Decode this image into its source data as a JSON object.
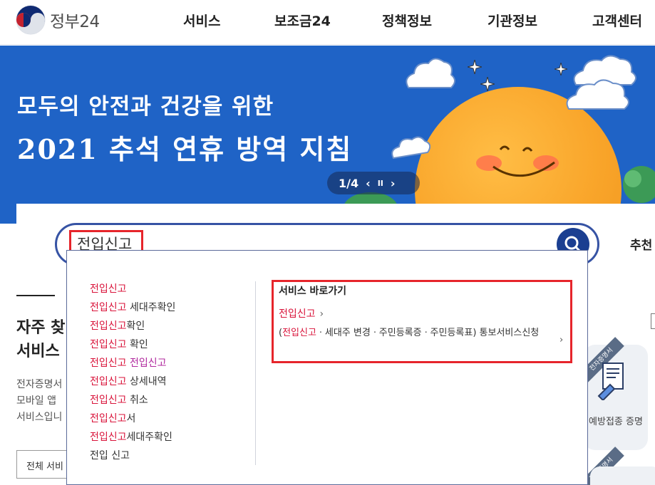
{
  "header": {
    "logo_text": "정부24",
    "nav": [
      "서비스",
      "보조금24",
      "정책정보",
      "기관정보",
      "고객센터"
    ]
  },
  "banner": {
    "line1": "모두의 안전과 건강을 위한",
    "line2": "2021 추석 연휴 방역 지침",
    "pager": "1/4",
    "prev": "‹",
    "pause": "II",
    "next": "›"
  },
  "search": {
    "value": "전입신고",
    "recommend_label": "추천"
  },
  "autocomplete": {
    "suggestions": [
      {
        "hit": "전입신고",
        "rest": "",
        "dup": ""
      },
      {
        "hit": "전입신고",
        "rest": " 세대주확인",
        "dup": ""
      },
      {
        "hit": "전입신고",
        "rest": "확인",
        "dup": ""
      },
      {
        "hit": "전입신고",
        "rest": " 확인",
        "dup": ""
      },
      {
        "hit": "전입신고",
        "rest": " ",
        "dup": "전입신고"
      },
      {
        "hit": "전입신고",
        "rest": " 상세내역",
        "dup": ""
      },
      {
        "hit": "전입신고",
        "rest": " 취소",
        "dup": ""
      },
      {
        "hit": "전입신고",
        "rest": "서",
        "dup": ""
      },
      {
        "hit": "전입신고",
        "rest": "세대주확인",
        "dup": ""
      },
      {
        "hit": "",
        "rest": "전입 신고",
        "dup": ""
      }
    ],
    "shortcut_title": "서비스 바로가기",
    "shortcut_item1": "전입신고",
    "shortcut_item2_open": "(",
    "shortcut_item2_hit": "전입신고",
    "shortcut_item2_rest": "ㆍ세대주 변경ㆍ주민등록증ㆍ주민등록표) 통보서비스신청"
  },
  "frequent": {
    "title_line1": "자주 찾",
    "title_line2": "서비스",
    "desc_line1": "전자증명서",
    "desc_line2": "모바일 앱",
    "desc_line3": "서비스입니",
    "select_label": "전체 서비"
  },
  "cards": {
    "card1_label": "예방접종 증명",
    "ribbon": "전자증명서"
  },
  "colors": {
    "brand_navy": "#1b3f91",
    "banner_blue": "#1f63c6",
    "highlight_red": "#e6252b",
    "match_text": "#d9133a"
  }
}
